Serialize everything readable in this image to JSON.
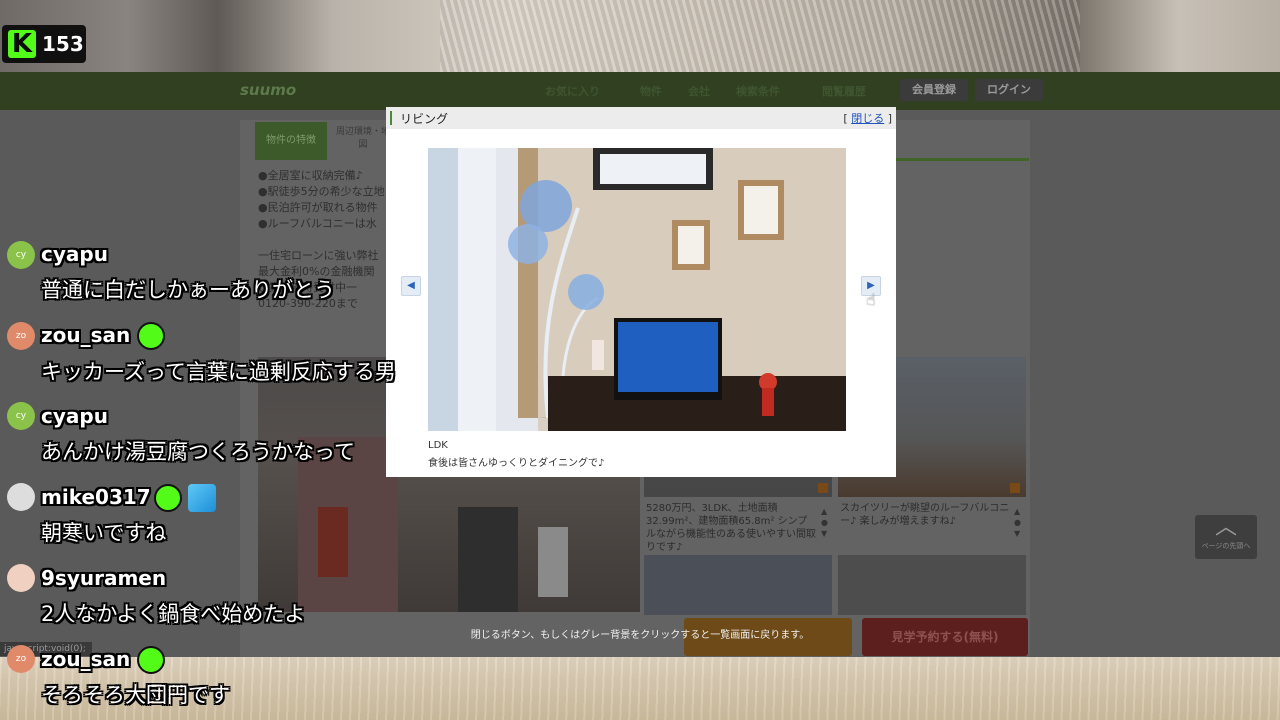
{
  "stream": {
    "viewer_count": "153",
    "kick_logo_letter": "K"
  },
  "site": {
    "logo": "suumo",
    "nav": [
      "お気に入り",
      "物件",
      "会社",
      "検索条件",
      "閲覧履歴"
    ],
    "register_label": "会員登録",
    "login_label": "ログイン",
    "tabs": {
      "features": "物件の特徴",
      "area": "周辺環境・地図"
    },
    "body_lines": [
      "●全居室に収納完備♪",
      "●駅徒歩5分の希少な立地",
      "●民泊許可が取れる物件",
      "●ルーフバルコニーは水",
      "",
      "一住宅ローンに強い弊社",
      "最大金利0%の金融機関",
      "ご案内随時受付中一",
      "0120-390-220まで"
    ],
    "listing_texts": {
      "a": "5280万円、3LDK、土地面積32.99m²、建物面積65.8m² シンプルながら機能性のある使いやすい間取りです♪",
      "b": "スカイツリーが眺望のルーフバルコニー♪ 楽しみが増えますね♪"
    },
    "visit_button": "見学予約する(無料)",
    "back_top": "ページの先頭へ",
    "close_hint": "閉じるボタン、もしくはグレー背景をクリックすると一覧画面に戻ります。",
    "js_status": "javascript:void(0);"
  },
  "modal": {
    "title": "リビング",
    "close_label": "閉じる",
    "prev_icon": "◀",
    "next_icon": "▶",
    "caption_1": "LDK",
    "caption_2": "食後は皆さんゆっくりとダイニングで♪"
  },
  "chat": [
    {
      "avatar": "cy",
      "avatar_color": "#8bc34a",
      "name": "cyapu",
      "badges": [],
      "message": "普通に白だしかぁーありがとう"
    },
    {
      "avatar": "zo",
      "avatar_color": "#e08a6a",
      "name": "zou_san",
      "badges": [
        "subscriber-icon"
      ],
      "message": "キッカーズって言葉に過剰反応する男"
    },
    {
      "avatar": "cy",
      "avatar_color": "#8bc34a",
      "name": "cyapu",
      "badges": [],
      "message": "あんかけ湯豆腐つくろうかなって"
    },
    {
      "avatar": "",
      "avatar_color": "#dddddd",
      "name": "mike0317",
      "badges": [
        "subscriber-icon",
        "gift-cube-icon"
      ],
      "message": "朝寒いですね"
    },
    {
      "avatar": "",
      "avatar_color": "#f0d0c0",
      "name": "9syuramen",
      "badges": [],
      "message": "2人なかよく鍋食べ始めたよ"
    },
    {
      "avatar": "zo",
      "avatar_color": "#e08a6a",
      "name": "zou_san",
      "badges": [
        "subscriber-icon"
      ],
      "message": "そろそろ大団円です"
    }
  ]
}
